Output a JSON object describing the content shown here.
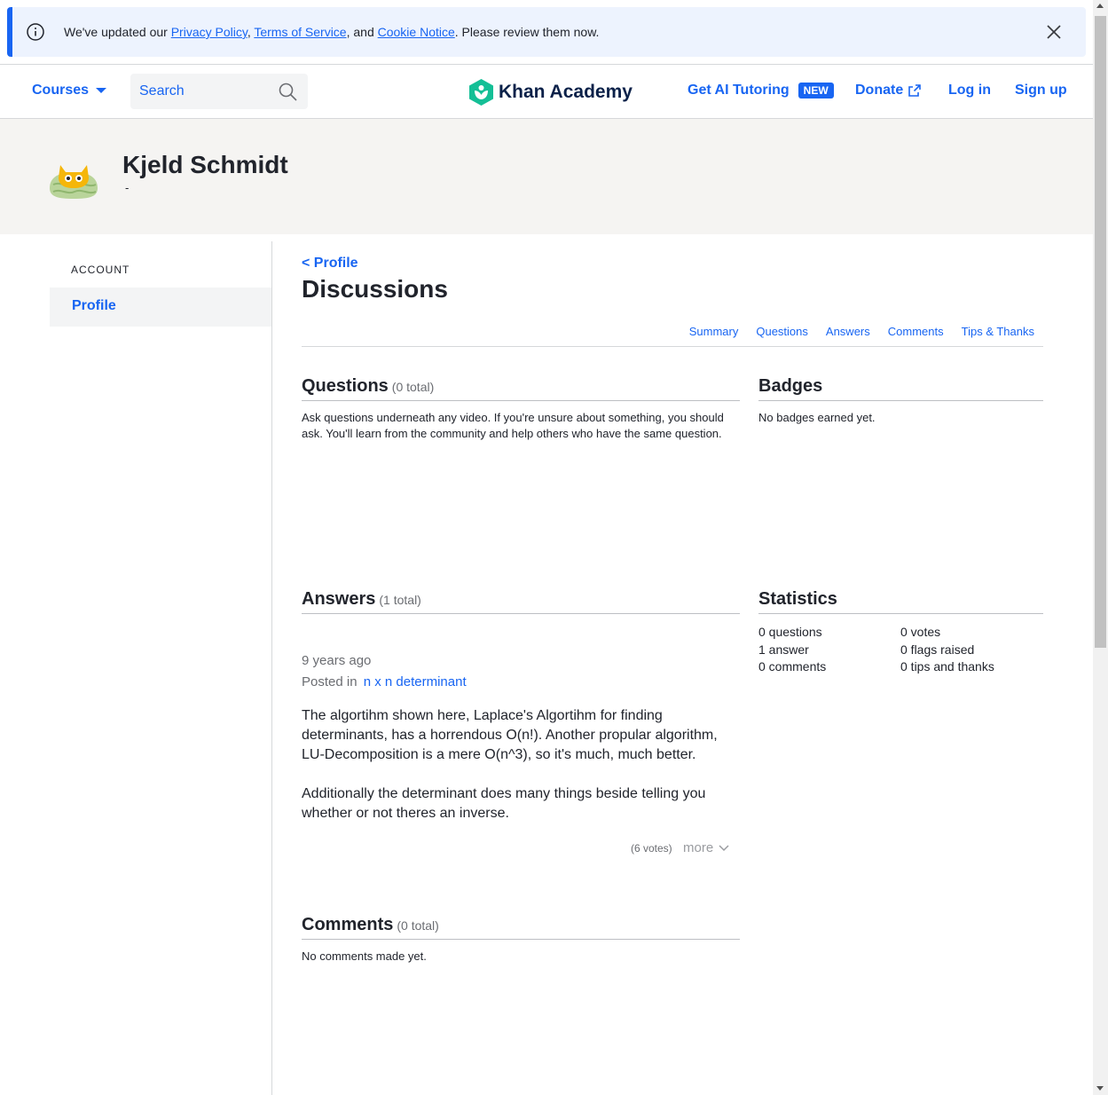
{
  "notice": {
    "prefix": "We've updated our ",
    "privacy": "Privacy Policy",
    "sep1": ", ",
    "terms": "Terms of Service",
    "sep2": ", and ",
    "cookie": "Cookie Notice",
    "suffix": ". Please review them now."
  },
  "header": {
    "courses": "Courses",
    "search_placeholder": "Search",
    "logo": "Khan Academy",
    "ai_tutoring": "Get AI Tutoring",
    "new_badge": "NEW",
    "donate": "Donate",
    "login": "Log in",
    "signup": "Sign up"
  },
  "profile": {
    "name": "Kjeld Schmidt",
    "sub": "-"
  },
  "sidebar": {
    "section_label": "ACCOUNT",
    "profile": "Profile"
  },
  "main": {
    "back_link": "< Profile",
    "title": "Discussions",
    "subnav": [
      "Summary",
      "Questions",
      "Answers",
      "Comments",
      "Tips & Thanks"
    ]
  },
  "questions": {
    "heading": "Questions",
    "total": "(0 total)",
    "text": "Ask questions underneath any video. If you're unsure about something, you should ask. You'll learn from the community and help others who have the same question."
  },
  "badges": {
    "heading": "Badges",
    "text": "No badges earned yet."
  },
  "answers": {
    "heading": "Answers",
    "total": "(1 total)",
    "items": [
      {
        "time": "9 years ago",
        "posted_in_label": "Posted in",
        "posted_in": "n x n determinant",
        "p1": "The algortihm shown here, Laplace's Algortihm for finding determinants, has a horrendous O(n!). Another propular algorithm, LU-Decomposition is a mere O(n^3), so it's much, much better.",
        "p2": "Additionally the determinant does many things beside telling you whether or not theres an inverse.",
        "votes": "(6 votes)",
        "more": "more"
      }
    ]
  },
  "statistics": {
    "heading": "Statistics",
    "col1": [
      "0 questions",
      "1 answer",
      "0 comments"
    ],
    "col2": [
      "0 votes",
      "0 flags raised",
      "0 tips and thanks"
    ]
  },
  "comments": {
    "heading": "Comments",
    "total": "(0 total)",
    "text": "No comments made yet."
  },
  "colors": {
    "accent": "#1865f2",
    "notice_bg": "#edf3fe",
    "band_bg": "#f5f4f2",
    "logo_green": "#14bf96"
  }
}
